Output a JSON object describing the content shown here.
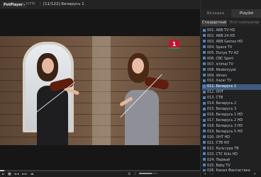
{
  "app": {
    "logo": "PotPlayer",
    "logo_caret": "▾",
    "protocol": "HTTP",
    "separator": "|",
    "title": "[11/122] Беларусь 1"
  },
  "video": {
    "channel_logo": "1"
  },
  "controls": {
    "play_icon": "►",
    "stop_icon": "■",
    "prev_icon": "◄◄",
    "next_icon": "►►",
    "open_icon": "⏏",
    "settings_icon": "⚙",
    "volume_icon": "♪",
    "seek_progress": 0.02,
    "volume_level": 0.7
  },
  "panel": {
    "tabs": [
      "Вкладка",
      "Playlist"
    ],
    "active_tab": 1,
    "subtabs": [
      "Стандартный",
      "Этот компьютер"
    ],
    "active_subtab": 0,
    "selected_index": 10,
    "items": [
      "001. ARB TV HD",
      "002. ARB 24 HD",
      "003. ARB Games HD",
      "004. Space TV",
      "005. Dunya TV AZ",
      "006. CBC Sport",
      "007. Ictimai TV",
      "008. Medeniyyet",
      "009. Idman",
      "010. Xazar TV",
      "011. Беларусь 1",
      "012. ОНТ",
      "013. СТВ",
      "014. Беларусь 2",
      "015. Беларусь 3",
      "016. Беларусь 1 HD",
      "017. Беларусь 2 HD",
      "018. Беларусь 3 HD",
      "019. Беларусь 5 HD",
      "020. ОНТ HD",
      "021. СТВ HD",
      "022. Культура ТВ",
      "023. СТС Kids HD",
      "024. Первый",
      "025. Baby TV",
      "026. Канал Фантастика"
    ],
    "footer": {
      "add": "+",
      "remove": "−",
      "menu": "≡"
    }
  }
}
